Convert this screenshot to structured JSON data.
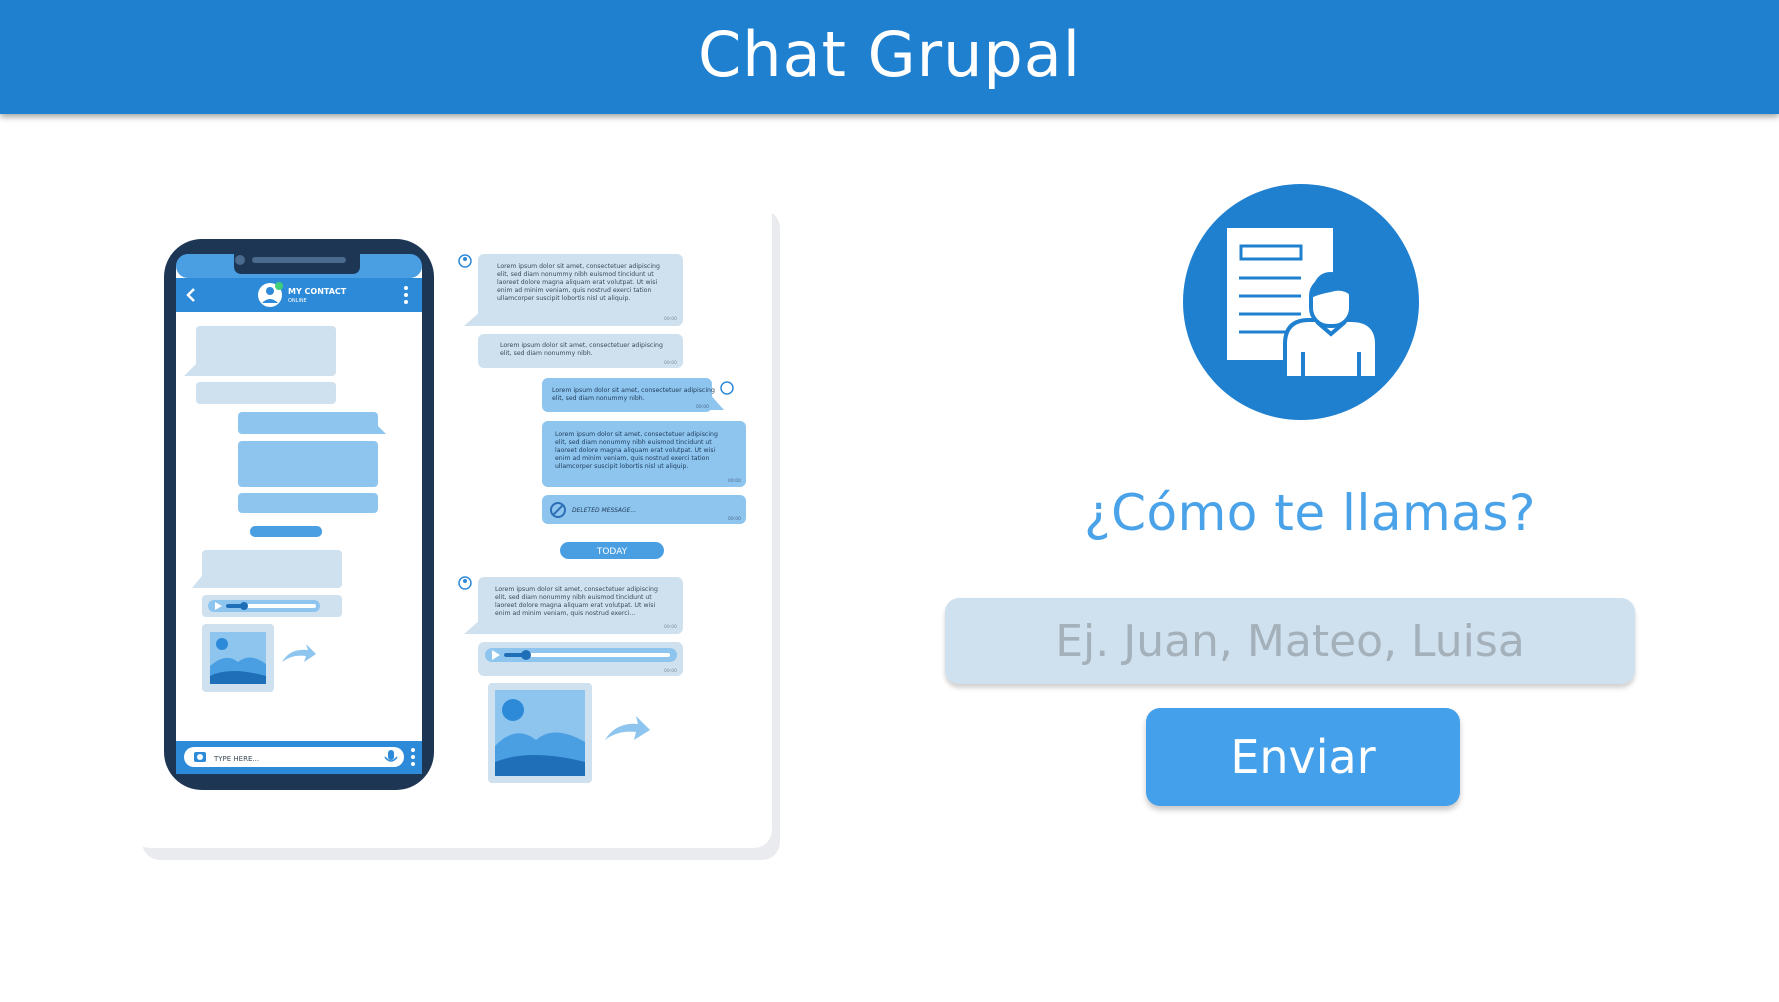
{
  "header": {
    "title": "Chat Grupal"
  },
  "illustration": {
    "contact_name": "MY CONTACT",
    "contact_status": "ONLINE",
    "compose_placeholder": "TYPE HERE...",
    "today_label": "TODAY",
    "deleted_message": "DELETED MESSAGE...",
    "lorem_long": [
      "Lorem ipsum dolor sit amet, consectetuer adipiscing",
      "elit, sed diam nonummy nibh euismod tincidunt ut",
      "laoreet dolore magna aliquam erat volutpat. Ut wisi",
      "enim ad minim veniam, quis nostrud exerci tation",
      "ullamcorper suscipit lobortis nisl ut aliquip."
    ],
    "lorem_short": [
      "Lorem ipsum dolor sit amet, consectetuer adipiscing",
      "elit, sed diam nonummy nibh."
    ],
    "lorem_last": [
      "Lorem ipsum dolor sit amet, consectetuer adipiscing",
      "elit, sed diam nonummy nibh euismod tincidunt ut",
      "laoreet dolore magna aliquam erat volutpat. Ut wisi",
      "enim ad minim veniam, quis nostrud exerci..."
    ],
    "time_label": "00:00"
  },
  "form": {
    "question": "¿Cómo te llamas?",
    "name_input": {
      "value": "",
      "placeholder": "Ej. Juan, Mateo, Luisa"
    },
    "send_label": "Enviar"
  },
  "colors": {
    "header": "#1f80d0",
    "accent": "#44a0ea",
    "question_text": "#4aa3e9",
    "input_bg": "#cfe1ee",
    "phone_frame": "#1d3654"
  },
  "icons": [
    "user-document-icon",
    "back-arrow-icon",
    "kebab-menu-icon",
    "camera-icon",
    "microphone-icon",
    "forward-arrow-icon",
    "image-icon",
    "play-icon",
    "blocked-icon"
  ]
}
